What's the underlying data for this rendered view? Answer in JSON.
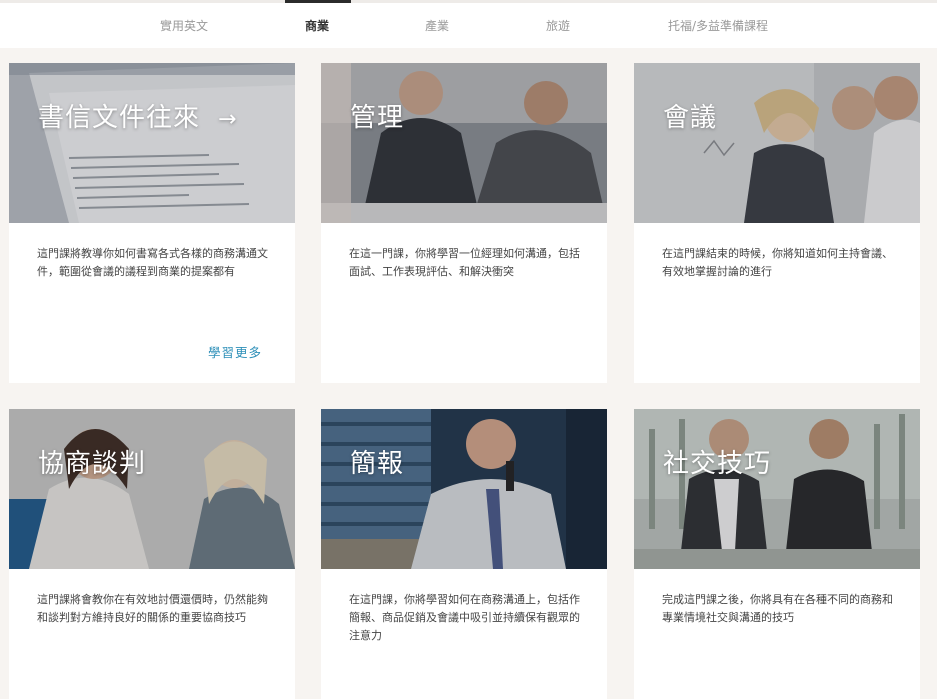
{
  "tabs": [
    {
      "label": "實用英文",
      "active": false
    },
    {
      "label": "商業",
      "active": true
    },
    {
      "label": "產業",
      "active": false
    },
    {
      "label": "旅遊",
      "active": false
    },
    {
      "label": "托福/多益準備課程",
      "active": false
    }
  ],
  "cards": [
    {
      "title": "書信文件往來",
      "arrow": "→",
      "desc": "這門課將教導你如何書寫各式各樣的商務溝通文件，範圍從會議的議程到商業的提案都有",
      "more": "學習更多"
    },
    {
      "title": "管理",
      "desc": "在這一門課，你將學習一位經理如何溝通，包括面試、工作表現評估、和解決衝突"
    },
    {
      "title": "會議",
      "desc": "在這門課結束的時候，你將知道如何主持會議、有效地掌握討論的進行"
    },
    {
      "title": "協商談判",
      "desc": "這門課將會教你在有效地討價還價時，仍然能夠和談判對方維持良好的關係的重要協商技巧"
    },
    {
      "title": "簡報",
      "desc": "在這門課，你將學習如何在商務溝通上，包括作簡報、商品促銷及會議中吸引並持續保有觀眾的注意力"
    },
    {
      "title": "社交技巧",
      "desc": "完成這門課之後，你將具有在各種不同的商務和專業情境社交與溝通的技巧"
    }
  ],
  "colors": {
    "accent": "#2d8fb8",
    "background": "#f7f4f1"
  }
}
